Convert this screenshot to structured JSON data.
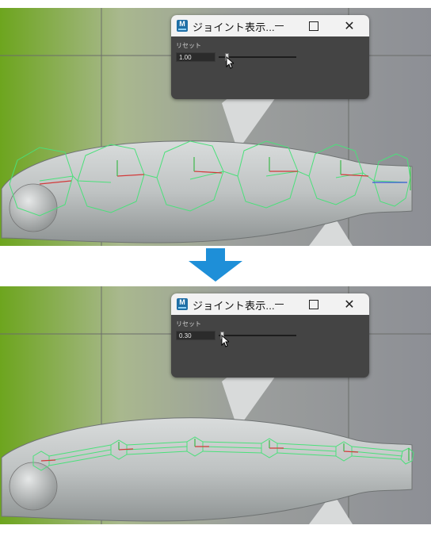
{
  "dialog": {
    "app_icon_letter": "M",
    "title": "ジョイント表示...",
    "reset_label": "リセット",
    "window_controls": {
      "minimize": "─",
      "maximize": "☐",
      "close": "✕"
    }
  },
  "panels": [
    {
      "field_value": "1.00",
      "slider_fraction": 0.1
    },
    {
      "field_value": "0.30",
      "slider_fraction": 0.03
    }
  ],
  "icons": [
    "app-icon",
    "minimize-icon",
    "maximize-icon",
    "close-icon",
    "mouse-cursor-icon",
    "down-arrow-icon"
  ],
  "colors": {
    "accent_arrow": "#1e8fd8",
    "joint_outline": "#4ae07a",
    "dialog_bg": "#444444",
    "titlebar_bg": "#f2f2f2"
  }
}
